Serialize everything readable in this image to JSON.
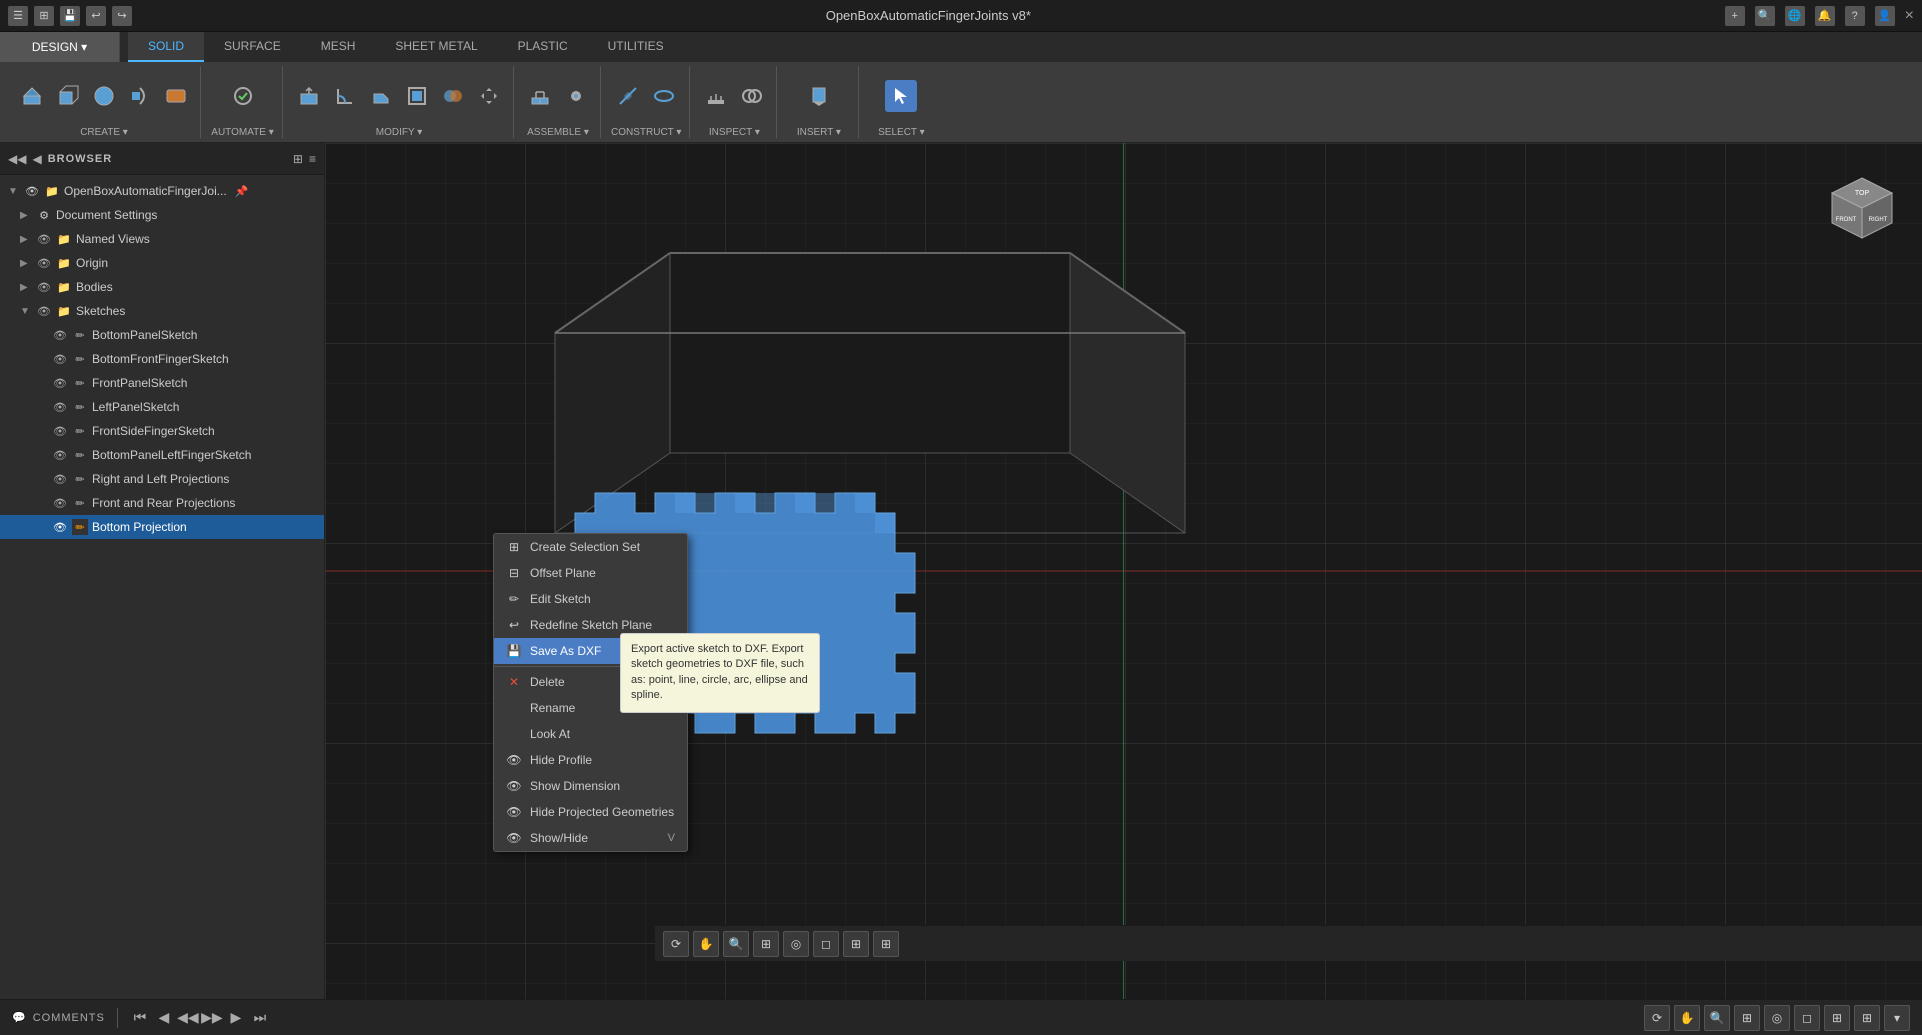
{
  "titleBar": {
    "title": "OpenBoxAutomaticFingerJoints v8*",
    "closeLabel": "×",
    "addLabel": "+",
    "icons": [
      "grid-icon",
      "globe-icon",
      "bell-icon",
      "help-icon",
      "user-icon"
    ]
  },
  "tabs": [
    {
      "label": "SOLID",
      "active": true
    },
    {
      "label": "SURFACE",
      "active": false
    },
    {
      "label": "MESH",
      "active": false
    },
    {
      "label": "SHEET METAL",
      "active": false
    },
    {
      "label": "PLASTIC",
      "active": false
    },
    {
      "label": "UTILITIES",
      "active": false
    }
  ],
  "toolGroups": [
    {
      "label": "CREATE ▾",
      "position": 0
    },
    {
      "label": "AUTOMATE ▾",
      "position": 1
    },
    {
      "label": "MODIFY ▾",
      "position": 2
    },
    {
      "label": "ASSEMBLE ▾",
      "position": 3
    },
    {
      "label": "CONSTRUCT ▾",
      "position": 4
    },
    {
      "label": "INSPECT ▾",
      "position": 5
    },
    {
      "label": "INSERT ▾",
      "position": 6
    },
    {
      "label": "SELECT ▾",
      "position": 7,
      "active": true
    }
  ],
  "designButton": "DESIGN ▾",
  "sidebar": {
    "header": "BROWSER",
    "items": [
      {
        "id": "root",
        "label": "OpenBoxAutomaticFingerJoi...",
        "indent": 0,
        "hasArrow": true,
        "icon": "document",
        "selected": false
      },
      {
        "id": "doc-settings",
        "label": "Document Settings",
        "indent": 1,
        "icon": "gear",
        "selected": false
      },
      {
        "id": "named-views",
        "label": "Named Views",
        "indent": 1,
        "icon": "folder",
        "selected": false
      },
      {
        "id": "origin",
        "label": "Origin",
        "indent": 1,
        "icon": "folder",
        "selected": false
      },
      {
        "id": "bodies",
        "label": "Bodies",
        "indent": 1,
        "icon": "folder",
        "selected": false
      },
      {
        "id": "sketches",
        "label": "Sketches",
        "indent": 1,
        "hasArrow": true,
        "icon": "folder",
        "selected": false
      },
      {
        "id": "sketch1",
        "label": "BottomPanelSketch",
        "indent": 2,
        "icon": "sketch",
        "selected": false
      },
      {
        "id": "sketch2",
        "label": "BottomFrontFingerSketch",
        "indent": 2,
        "icon": "sketch",
        "selected": false
      },
      {
        "id": "sketch3",
        "label": "FrontPanelSketch",
        "indent": 2,
        "icon": "sketch",
        "selected": false
      },
      {
        "id": "sketch4",
        "label": "LeftPanelSketch",
        "indent": 2,
        "icon": "sketch",
        "selected": false
      },
      {
        "id": "sketch5",
        "label": "FrontSideFingerSketch",
        "indent": 2,
        "icon": "sketch",
        "selected": false
      },
      {
        "id": "sketch6",
        "label": "BottomPanelLeftFingerSketch",
        "indent": 2,
        "icon": "sketch",
        "selected": false
      },
      {
        "id": "sketch7",
        "label": "Right and Left Projections",
        "indent": 2,
        "icon": "sketch",
        "selected": false
      },
      {
        "id": "sketch8",
        "label": "Front and Rear Projections",
        "indent": 2,
        "icon": "sketch",
        "selected": false
      },
      {
        "id": "sketch9",
        "label": "Bottom Projection",
        "indent": 2,
        "icon": "sketch",
        "selected": true
      }
    ]
  },
  "contextMenu": {
    "items": [
      {
        "label": "Create Selection Set",
        "icon": "selection",
        "shortcut": "",
        "disabled": false,
        "highlighted": false
      },
      {
        "label": "Offset Plane",
        "icon": "plane",
        "shortcut": "",
        "disabled": false,
        "highlighted": false
      },
      {
        "label": "Edit Sketch",
        "icon": "edit",
        "shortcut": "",
        "disabled": false,
        "highlighted": false
      },
      {
        "label": "Redefine Sketch Plane",
        "icon": "redefine",
        "shortcut": "",
        "disabled": false,
        "highlighted": false
      },
      {
        "label": "Save As DXF",
        "icon": "dxf",
        "shortcut": "",
        "disabled": false,
        "highlighted": true
      },
      {
        "label": "Delete",
        "icon": "delete",
        "shortcut": "",
        "disabled": false,
        "highlighted": false,
        "isDelete": true
      },
      {
        "label": "Rename",
        "icon": "",
        "shortcut": "",
        "disabled": false,
        "highlighted": false
      },
      {
        "label": "Look At",
        "icon": "",
        "shortcut": "",
        "disabled": false,
        "highlighted": false
      },
      {
        "label": "Hide Profile",
        "icon": "eye",
        "shortcut": "",
        "disabled": false,
        "highlighted": false
      },
      {
        "label": "Show Dimension",
        "icon": "eye",
        "shortcut": "",
        "disabled": false,
        "highlighted": false
      },
      {
        "label": "Hide Projected Geometries",
        "icon": "eye",
        "shortcut": "",
        "disabled": false,
        "highlighted": false
      },
      {
        "label": "Show/Hide",
        "icon": "eye",
        "shortcut": "V",
        "disabled": false,
        "highlighted": false
      }
    ]
  },
  "tooltip": {
    "text": "Export active sketch to DXF. Export sketch geometries to DXF file, such as: point, line, circle, arc, ellipse and spline."
  },
  "statusBar": {
    "comments": "COMMENTS",
    "viewportLabel": "Bottom Projection"
  },
  "playback": {
    "buttons": [
      "⏮",
      "◀",
      "◀◀",
      "▶",
      "▶▶",
      "⏭"
    ]
  }
}
